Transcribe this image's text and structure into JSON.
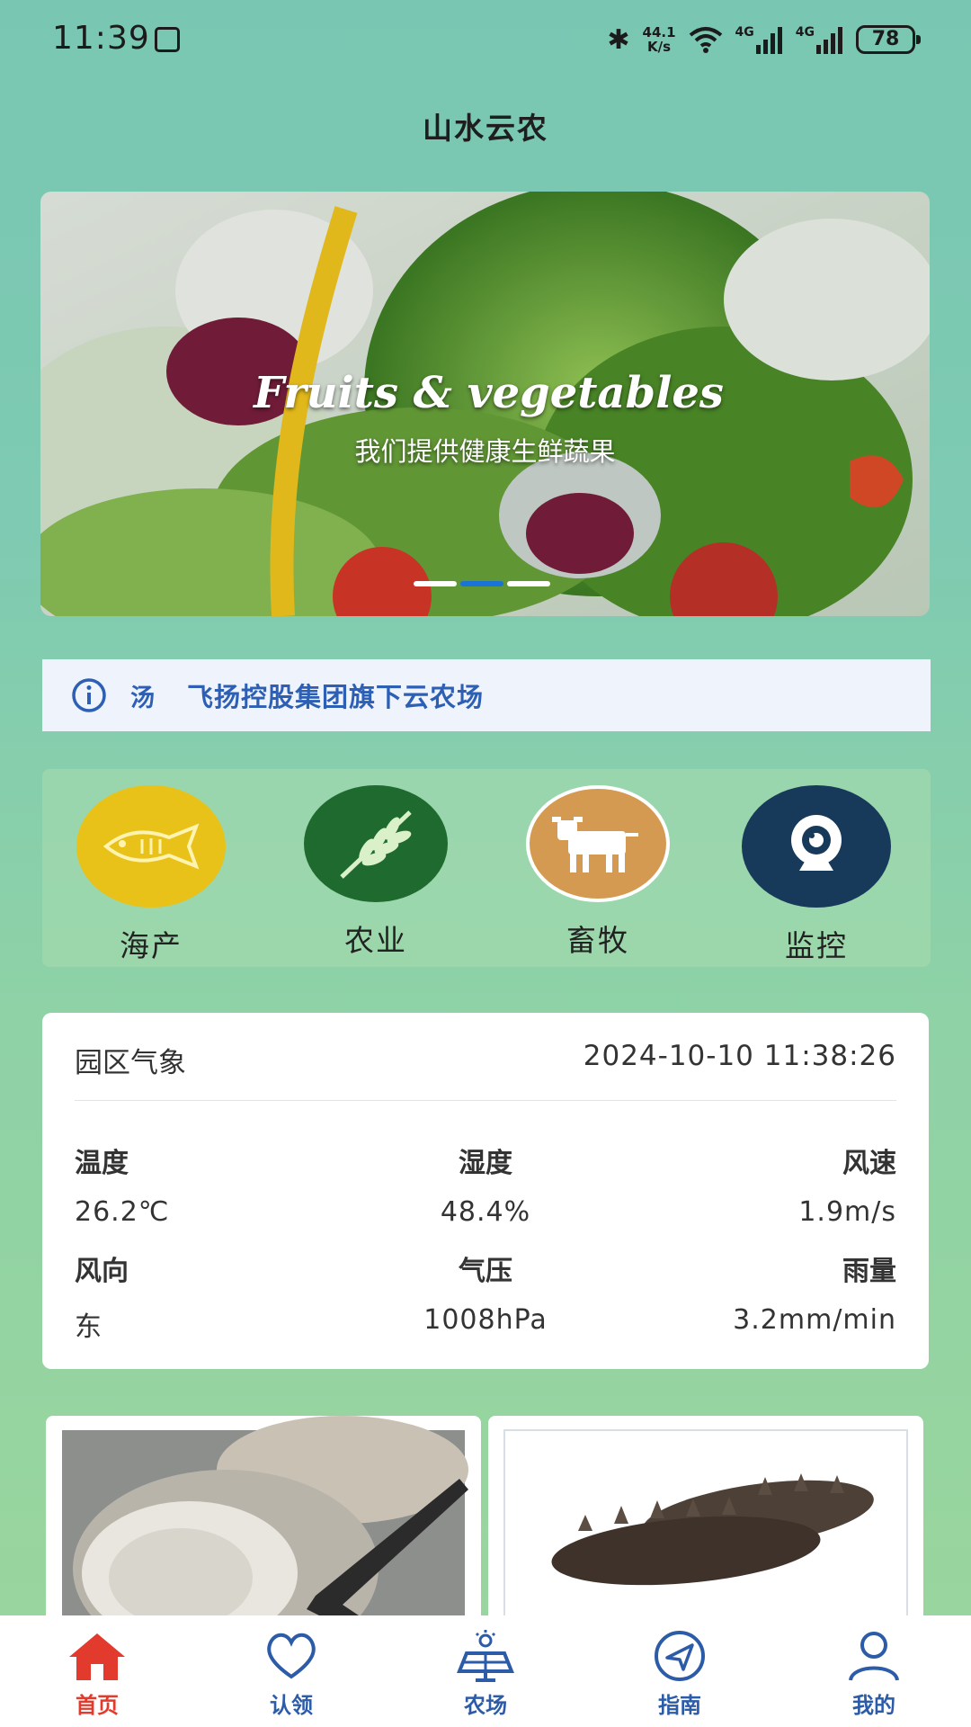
{
  "status_bar": {
    "time": "11:39",
    "network_speed_value": "44.1",
    "network_speed_unit": "K/s",
    "signal_label_1": "4G",
    "signal_label_2": "4G",
    "battery": "78"
  },
  "app_title": "山水云农",
  "banner": {
    "title": "Fruits & vegetables",
    "subtitle": "我们提供健康生鲜蔬果",
    "slide_count": 3,
    "active_slide": 2
  },
  "notice": {
    "prefix": "汤",
    "text": "飞扬控股集团旗下云农场"
  },
  "categories": [
    {
      "label": "海产",
      "icon": "fish-icon",
      "color": "#e8c219"
    },
    {
      "label": "农业",
      "icon": "wheat-icon",
      "color": "#1f6b2f"
    },
    {
      "label": "畜牧",
      "icon": "cow-icon",
      "color": "#d49a52"
    },
    {
      "label": "监控",
      "icon": "camera-icon",
      "color": "#173a5a"
    }
  ],
  "weather": {
    "title": "园区气象",
    "datetime": "2024-10-10 11:38:26",
    "items": [
      {
        "label": "温度",
        "value": "26.2℃"
      },
      {
        "label": "湿度",
        "value": "48.4%"
      },
      {
        "label": "风速",
        "value": "1.9m/s"
      },
      {
        "label": "风向",
        "value": "东"
      },
      {
        "label": "气压",
        "value": "1008hPa"
      },
      {
        "label": "雨量",
        "value": "3.2mm/min"
      }
    ]
  },
  "products": [
    {
      "name": "oyster-image"
    },
    {
      "name": "sea-cucumber-image"
    }
  ],
  "tabbar": [
    {
      "label": "首页",
      "icon": "home-icon",
      "active": true
    },
    {
      "label": "认领",
      "icon": "heart-icon",
      "active": false
    },
    {
      "label": "农场",
      "icon": "solar-farm-icon",
      "active": false
    },
    {
      "label": "指南",
      "icon": "compass-icon",
      "active": false
    },
    {
      "label": "我的",
      "icon": "user-icon",
      "active": false
    }
  ],
  "colors": {
    "accent_blue": "#2c5ba8",
    "active_red": "#e23b2e",
    "notice_text": "#2d5fb4"
  }
}
